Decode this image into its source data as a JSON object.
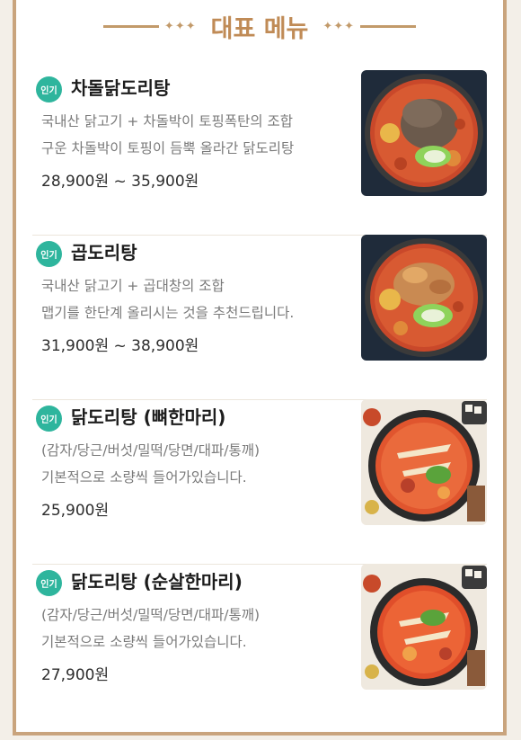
{
  "header": {
    "title": "대표 메뉴",
    "left_ornament": "✦✦✦",
    "right_ornament": "✦✦✦"
  },
  "menu": {
    "items": [
      {
        "badge": "인기",
        "name": "차돌닭도리탕",
        "desc1": "국내산 닭고기 + 차돌박이 토핑폭탄의 조합",
        "desc2": "구운 차돌박이 토핑이 듬뿍 올라간 닭도리탕",
        "price": "28,900원 ~ 35,900원",
        "photo_icon": "stew-bowl-icon"
      },
      {
        "badge": "인기",
        "name": "곱도리탕",
        "desc1": "국내산 닭고기 + 곱대창의 조합",
        "desc2": "맵기를 한단계 올리시는 것을 추천드립니다.",
        "price": "31,900원 ~ 38,900원",
        "photo_icon": "stew-bowl-icon"
      },
      {
        "badge": "인기",
        "name": "닭도리탕 (뼈한마리)",
        "desc1": "(감자/당근/버섯/밀떡/당면/대파/통깨)",
        "desc2": "기본적으로 소량씩 들어가있습니다.",
        "price": "25,900원",
        "photo_icon": "stew-pot-icon"
      },
      {
        "badge": "인기",
        "name": "닭도리탕 (순살한마리)",
        "desc1": "(감자/당근/버섯/밀떡/당면/대파/통깨)",
        "desc2": "기본적으로 소량씩 들어가있습니다.",
        "price": "27,900원",
        "photo_icon": "stew-pot-icon"
      }
    ]
  },
  "colors": {
    "accent": "#c08b56",
    "badge": "#2eb59d"
  }
}
